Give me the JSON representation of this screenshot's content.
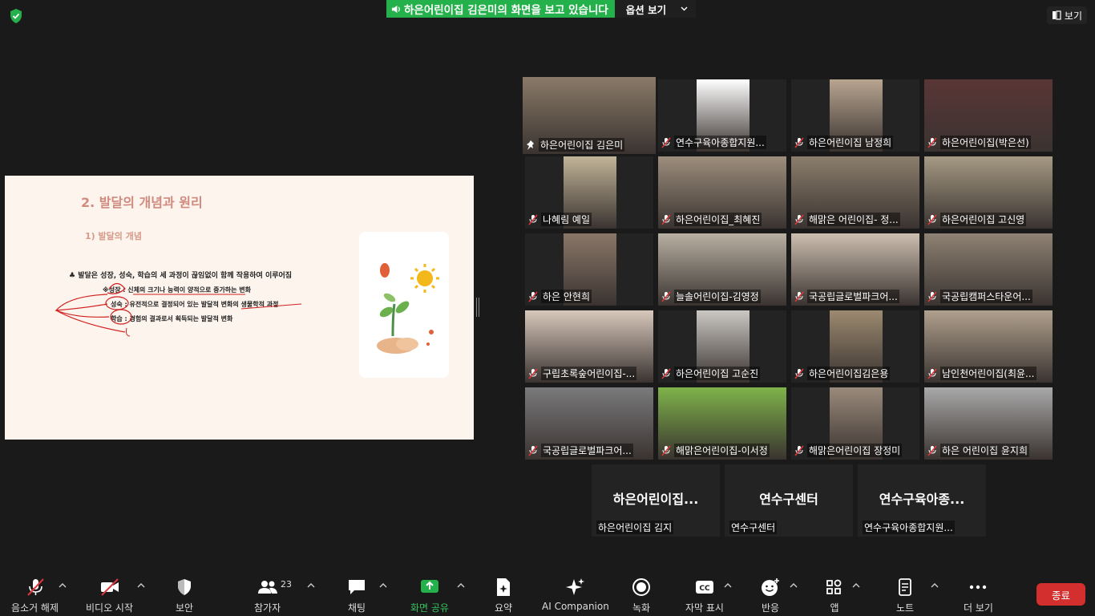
{
  "banner": {
    "text": "하은어린이집 김은미의 화면을 보고 있습니다",
    "options": "옵션 보기"
  },
  "view_label": "보기",
  "slide": {
    "title": "2. 발달의 개념과 원리",
    "subtitle": "1) 발달의 개념",
    "main": "♣ 발달은 성장, 성숙, 학습의 세 과정이 끊임없이 함께 작용하여 이루어짐",
    "items": [
      "※성장 : 신체의 크기나 능력이 양적으로 증가하는 변화",
      "성숙 : 유전적으로 결정되어 있는 발달적 변화의 생물학적 과정",
      "학습 : 경험의 결과로서 획득되는 발달적 변화"
    ]
  },
  "participants": [
    {
      "name": "하은어린이집 김은미",
      "color": "#8a7a68",
      "active": true,
      "mic": "pin"
    },
    {
      "name": "연수구육아종합지원...",
      "color": "#ffffff",
      "mic": "muted"
    },
    {
      "name": "하은어린이집 남정희",
      "color": "#b8a590",
      "mic": "muted"
    },
    {
      "name": "하은어린이집(박은선)",
      "color": "#5a3636",
      "mic": "muted"
    },
    {
      "name": "나혜림 예일",
      "color": "#c2b498",
      "mic": "muted"
    },
    {
      "name": "하은어린이집_최혜진",
      "color": "#9d8e7d",
      "mic": "muted"
    },
    {
      "name": "해맑은 어린이집- 정...",
      "color": "#8b7e6c",
      "mic": "muted"
    },
    {
      "name": "하은어린이집 고신영",
      "color": "#a69a84",
      "mic": "muted"
    },
    {
      "name": "하은 안현희",
      "color": "#8a7768",
      "mic": "muted"
    },
    {
      "name": "늘솔어린이집-김영정",
      "color": "#b8b0a2",
      "mic": "muted"
    },
    {
      "name": "국공립글로벌파크어...",
      "color": "#cdbfb0",
      "mic": "muted"
    },
    {
      "name": "국공립캠퍼스타운어...",
      "color": "#8f8274",
      "mic": "muted"
    },
    {
      "name": "구립초록숲어린이집-...",
      "color": "#d8c8bc",
      "mic": "muted"
    },
    {
      "name": "하은어린이집 고순진",
      "color": "#cbc8c3",
      "mic": "muted"
    },
    {
      "name": "하은어린이집김은용",
      "color": "#9c8a70",
      "mic": "muted"
    },
    {
      "name": "남인천어린이집(최윤...",
      "color": "#b0a08e",
      "mic": "muted"
    },
    {
      "name": "국공립글로벌파크어...",
      "color": "#7a7a7c",
      "mic": "muted"
    },
    {
      "name": "해맑은어린이집-이서정",
      "color": "#7fb34a",
      "mic": "muted"
    },
    {
      "name": "해맑은어린이집 장정미",
      "color": "#9a8a7a",
      "mic": "muted"
    },
    {
      "name": "하은 어린이집 윤지희",
      "color": "#a9a9a9",
      "mic": "muted"
    }
  ],
  "no_video": [
    {
      "big": "하은어린이집...",
      "name": "하은어린이집 김지"
    },
    {
      "big": "연수구센터",
      "name": "연수구센터"
    },
    {
      "big": "연수구육아종...",
      "name": "연수구육아종합지원..."
    }
  ],
  "toolbar": {
    "mute": "음소거 해제",
    "video": "비디오 시작",
    "security": "보안",
    "participants": "참가자",
    "participants_count": "23",
    "chat": "채팅",
    "share": "화면 공유",
    "summary": "요약",
    "ai": "AI Companion",
    "record": "녹화",
    "captions": "자막 표시",
    "reactions": "반응",
    "apps": "앱",
    "notes": "노트",
    "more": "더 보기",
    "end": "종료"
  },
  "colors": {
    "share_green": "#24b04a",
    "active_border": "#dfe052",
    "end_red": "#d32f2f",
    "muted_red": "#e0353b"
  }
}
